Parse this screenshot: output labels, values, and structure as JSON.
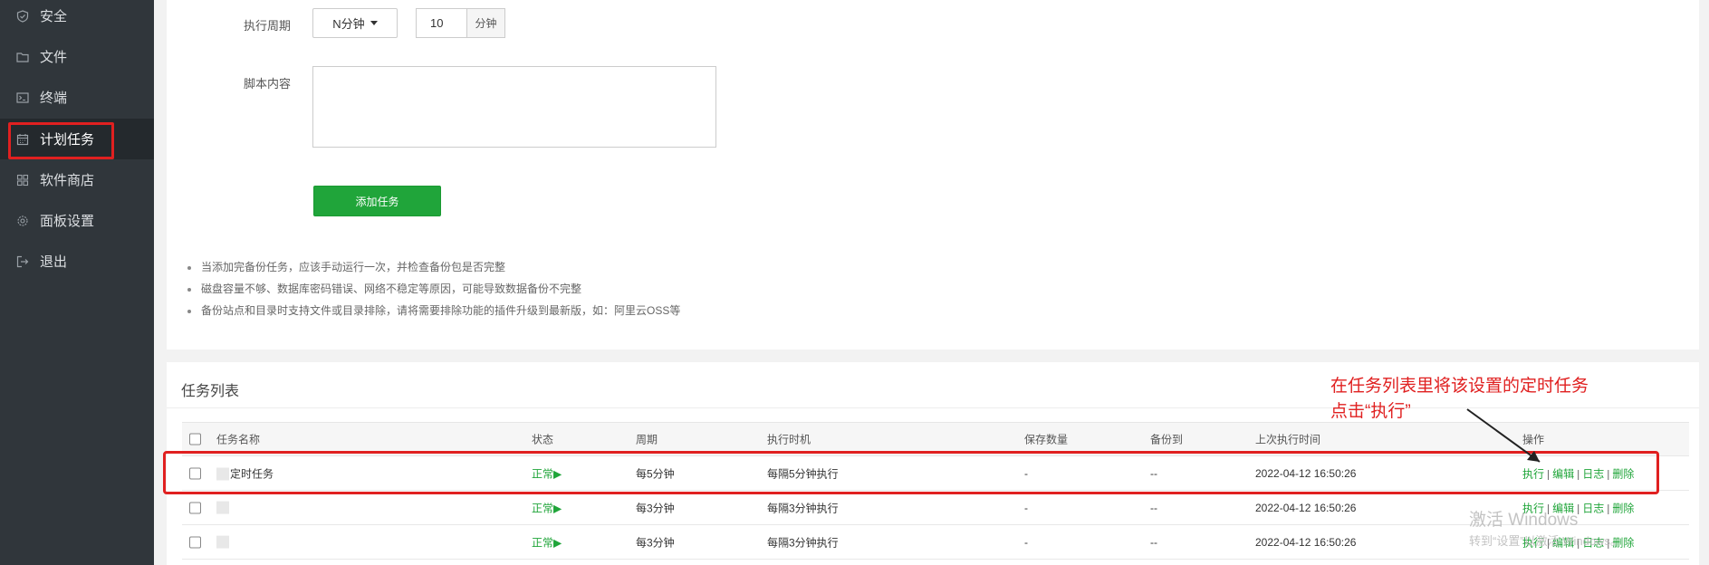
{
  "sidebar": {
    "items": [
      {
        "label": "安全",
        "icon": "shield-icon"
      },
      {
        "label": "文件",
        "icon": "folder-icon"
      },
      {
        "label": "终端",
        "icon": "terminal-icon"
      },
      {
        "label": "计划任务",
        "icon": "calendar-icon",
        "active": true
      },
      {
        "label": "软件商店",
        "icon": "grid-icon"
      },
      {
        "label": "面板设置",
        "icon": "gear-icon"
      },
      {
        "label": "退出",
        "icon": "logout-icon"
      }
    ]
  },
  "form": {
    "period_label": "执行周期",
    "period_select": "N分钟",
    "minutes_value": "10",
    "minutes_unit": "分钟",
    "script_label": "脚本内容",
    "add_button": "添加任务"
  },
  "tips": [
    "当添加完备份任务，应该手动运行一次，并检查备份包是否完整",
    "磁盘容量不够、数据库密码错误、网络不稳定等原因，可能导致数据备份不完整",
    "备份站点和目录时支持文件或目录排除，请将需要排除功能的插件升级到最新版，如：阿里云OSS等"
  ],
  "task_list": {
    "title": "任务列表",
    "columns": [
      "任务名称",
      "状态",
      "周期",
      "执行时机",
      "保存数量",
      "备份到",
      "上次执行时间",
      "操作"
    ],
    "rows": [
      {
        "name": "定时任务",
        "status": "正常▶",
        "period": "每5分钟",
        "exec": "每隔5分钟执行",
        "keep": "-",
        "backup": "--",
        "last": "2022-04-12 16:50:26"
      },
      {
        "name": "",
        "status": "正常▶",
        "period": "每3分钟",
        "exec": "每隔3分钟执行",
        "keep": "-",
        "backup": "--",
        "last": "2022-04-12 16:50:26"
      },
      {
        "name": "",
        "status": "正常▶",
        "period": "每3分钟",
        "exec": "每隔3分钟执行",
        "keep": "-",
        "backup": "--",
        "last": "2022-04-12 16:50:26"
      }
    ],
    "ops": {
      "run": "执行",
      "edit": "编辑",
      "log": "日志",
      "delete": "删除",
      "sep": "|"
    }
  },
  "annotation": {
    "line1": "在任务列表里将该设置的定时任务",
    "line2": "点击“执行”",
    "color": "#e02020"
  },
  "watermark": {
    "line1": "激活 Windows",
    "line2": "转到“设置”以激活 Windows。"
  },
  "colors": {
    "accent": "#20a53a",
    "sidebar_bg": "#30363b",
    "annotation": "#e02020"
  }
}
